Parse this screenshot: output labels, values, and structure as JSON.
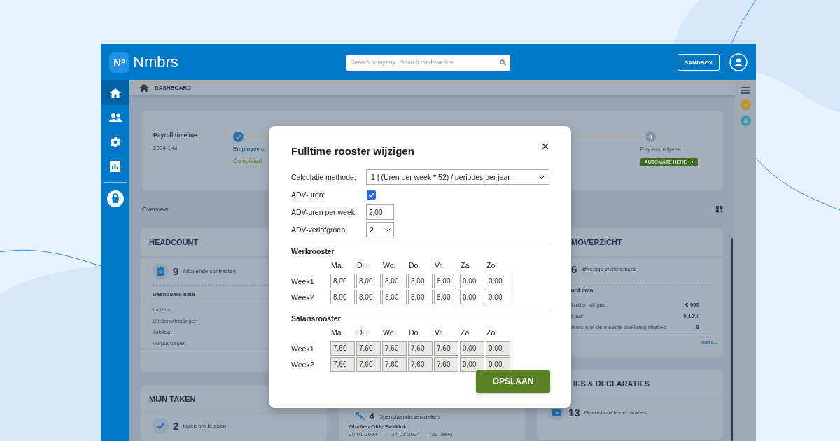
{
  "topbar": {
    "logo_badge": "Nº",
    "brand": "Nmbrs",
    "search": {
      "placeholder": "Search company | Search medewerker"
    },
    "sandbox_button": "SANDBOX"
  },
  "sidebar": {
    "items": [
      {
        "kind": "home",
        "selected": true
      },
      {
        "kind": "people",
        "selected": false
      },
      {
        "kind": "settings",
        "selected": false
      },
      {
        "kind": "chart",
        "selected": false
      },
      {
        "kind": "bag",
        "selected": false
      }
    ]
  },
  "breadcrumb": "DASHBOARD",
  "timeline": {
    "title": "Payroll timeline",
    "period": "2004-1-M",
    "steps": [
      {
        "kind": "done",
        "label": "Employee c",
        "status": "Completed"
      },
      {
        "kind": "pending",
        "number": "4",
        "label": "Pay employees",
        "action": "AUTOMATE HERE"
      }
    ]
  },
  "overview": {
    "title": "Overview"
  },
  "headcount": {
    "title": "HEADCOUNT",
    "count": "9",
    "count_label": "Aflopende contracten",
    "table_title": "Dashboard data",
    "rows": [
      "Indienst",
      "Uitdiensttredingen",
      "Jubilea",
      "Verjaardagen"
    ]
  },
  "tasks": {
    "title": "MIJN TAKEN",
    "count": "2",
    "count_label": "taken om te doen"
  },
  "requests": {
    "count": "4",
    "count_label": "Openstaande verzoeken",
    "name": "Ottelien Olde Bekkink",
    "from": "20-01-2024",
    "arrow": "→",
    "to": "24-01-2024",
    "hours": "(36 uren)"
  },
  "absence": {
    "title": "MOVERZICHT",
    "count": "6",
    "count_label": "afwezige werknemers",
    "table_title": "ard data",
    "rows": [
      {
        "label": "kosten dit jaar",
        "value": "€ 900"
      },
      {
        "label": "t jaar",
        "value": "0.19%"
      },
      {
        "label": "rkers met de meeste ziekteregistraties",
        "value": "9"
      }
    ],
    "more": "more..."
  },
  "declarations": {
    "title": "IES & DECLARATIES",
    "count": "13",
    "count_label": "Openstaande declaraties"
  },
  "modal": {
    "title": "Fulltime rooster wijzigen",
    "fields": [
      {
        "kind": "menu",
        "label": "Calculatie methode:",
        "value": "1 | (Uren per week * 52) / periodes per jaar"
      },
      {
        "kind": "checkbox",
        "label": "ADV-uren:",
        "checked": true
      },
      {
        "kind": "input",
        "label": "ADV-uren per week:",
        "value": "2,00"
      },
      {
        "kind": "select",
        "label": "ADV-verlofgroep:",
        "value": "2"
      }
    ],
    "schedules": [
      {
        "title": "Werkrooster",
        "editable": true,
        "days": [
          "Ma.",
          "Di.",
          "Wo.",
          "Do.",
          "Vr.",
          "Za.",
          "Zo."
        ],
        "weeks": [
          {
            "label": "Week1",
            "values": [
              "8,00",
              "8,00",
              "8,00",
              "8,00",
              "8,00",
              "0,00",
              "0,00"
            ]
          },
          {
            "label": "Week2",
            "values": [
              "8,00",
              "8,00",
              "8,00",
              "8,00",
              "8,00",
              "0,00",
              "0,00"
            ]
          }
        ]
      },
      {
        "title": "Salarisrooster",
        "editable": false,
        "days": [
          "Ma.",
          "Di.",
          "Wo.",
          "Do.",
          "Vr.",
          "Za.",
          "Zo."
        ],
        "weeks": [
          {
            "label": "Week1",
            "values": [
              "7,60",
              "7,60",
              "7,60",
              "7,60",
              "7,60",
              "0,00",
              "0,00"
            ]
          },
          {
            "label": "Week2",
            "values": [
              "7,60",
              "7,60",
              "7,60",
              "7,60",
              "7,60",
              "0,00",
              "0,00"
            ]
          }
        ]
      }
    ],
    "save_button": "OPSLAAN"
  }
}
